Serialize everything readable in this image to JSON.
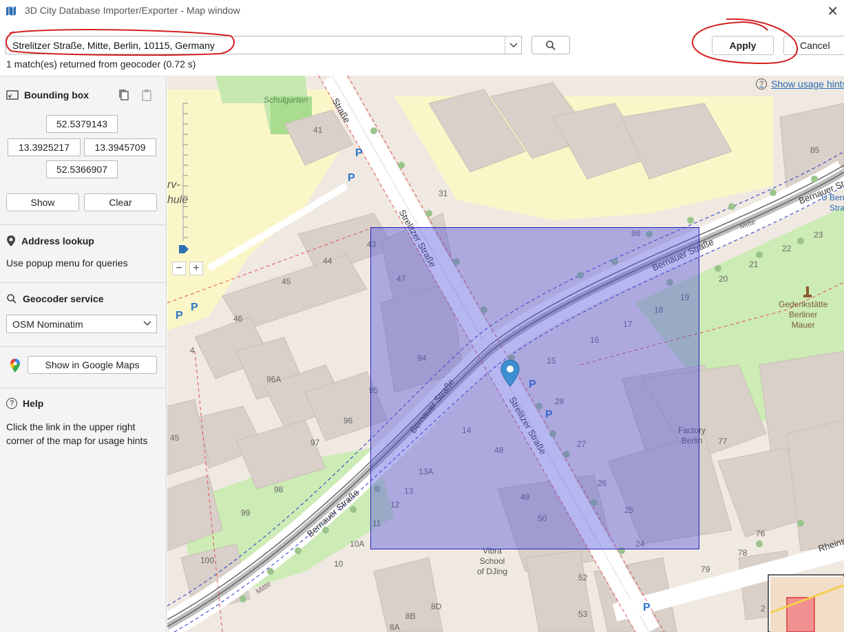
{
  "window": {
    "title": "3D City Database Importer/Exporter - Map window",
    "close_glyph": "✕"
  },
  "search": {
    "value": "Strelitzer Straße, Mitte, Berlin, 10115, Germany",
    "status": "1 match(es) returned from geocoder (0.72 s)"
  },
  "actions": {
    "apply_label": "Apply",
    "cancel_label": "Cancel"
  },
  "panel": {
    "bbox_title": "Bounding box",
    "north": "52.5379143",
    "west": "13.3925217",
    "east": "13.3945709",
    "south": "52.5366907",
    "show_label": "Show",
    "clear_label": "Clear",
    "address_title": "Address lookup",
    "address_hint": "Use popup menu for queries",
    "geocoder_title": "Geocoder service",
    "geocoder_selected": "OSM Nominatim",
    "google_maps_label": "Show in Google Maps",
    "help_title": "Help",
    "help_text": "Click the link in the upper right corner of the map for usage hints"
  },
  "map": {
    "usage_link": "Show usage hints",
    "zoom_in": "+",
    "zoom_out": "−",
    "streets": {
      "strelitzer_1": "Straße",
      "strelitzer_2": "Strelitzer Straße",
      "strelitzer_3": "Strelitzer Straße",
      "bernauer_1": "Bernauer Straße",
      "bernauer_2": "Bernauer Straße",
      "bernauer_3": "Bernauer Straße",
      "bernauer_4": "Bernauer Str",
      "rheins": "Rheins",
      "mitte_1": "Mitte",
      "mitte_2": "Mitte",
      "u_bernauer": "U Berna",
      "u_bernauer_2": "Stra"
    },
    "pois": {
      "schulgarten": "Schulgarten",
      "gedenk": "Gedenkstätte\nBerliner\nMauer",
      "factory": "Factory\nBerlin",
      "vibra": "Vibra\nSchool\nof DJing",
      "schule_a": "rv-",
      "schule_b": "hule"
    },
    "house_numbers": [
      "41",
      "31",
      "43",
      "44",
      "45",
      "46",
      "47",
      "94",
      "95",
      "96",
      "96A",
      "97",
      "98",
      "99",
      "100",
      "10",
      "10A",
      "11",
      "12",
      "13",
      "13A",
      "14",
      "48",
      "49",
      "50",
      "52",
      "53",
      "8D",
      "8B",
      "8A",
      "15",
      "16",
      "17",
      "18",
      "19",
      "20",
      "21",
      "22",
      "23",
      "24",
      "25",
      "26",
      "27",
      "28",
      "77",
      "76",
      "78",
      "79",
      "85",
      "86",
      "45",
      "4",
      "2"
    ],
    "colors": {
      "bbox_fill": "#5050dc",
      "bbox_border": "#2020c0",
      "marker": "#3d8fd1",
      "annotation": "#d42020"
    }
  }
}
